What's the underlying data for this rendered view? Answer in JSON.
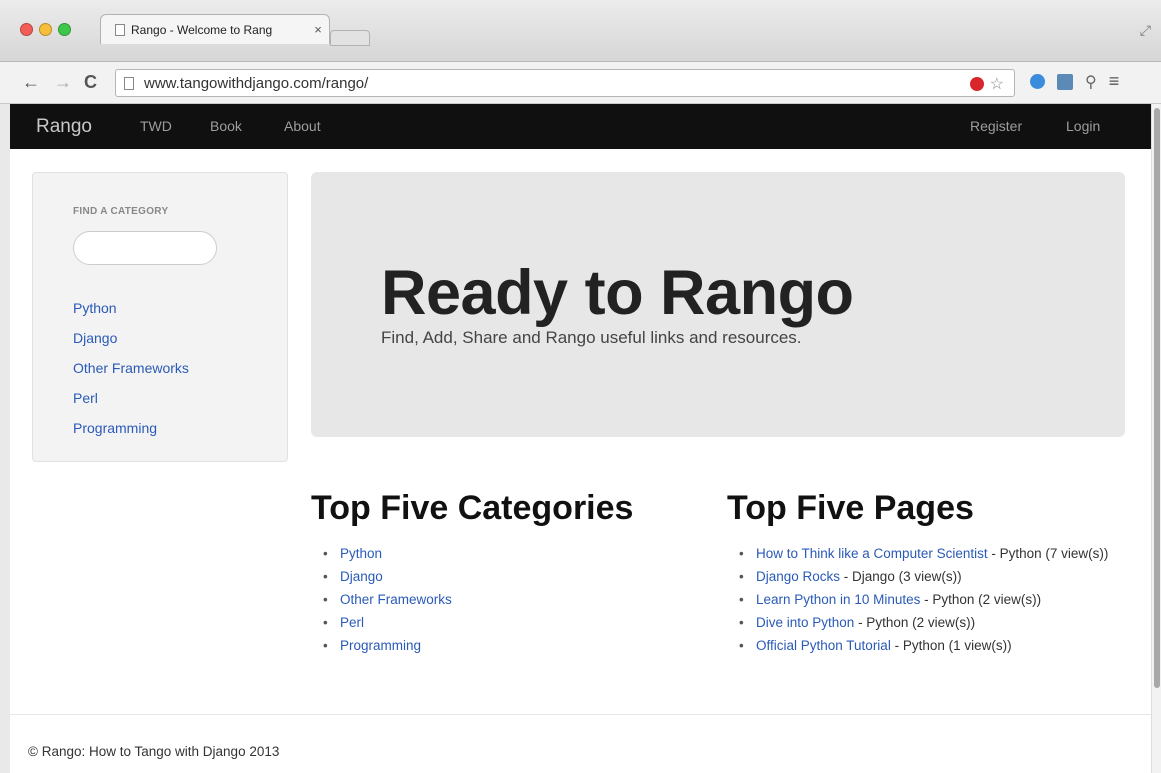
{
  "browser": {
    "tab_title": "Rango - Welcome to Rang",
    "tab_close": "×",
    "url": "www.tangowithdjango.com/rango/"
  },
  "navbar": {
    "brand": "Rango",
    "links": [
      "TWD",
      "Book",
      "About"
    ],
    "right_links": [
      "Register",
      "Login"
    ]
  },
  "sidebar": {
    "heading": "FIND A CATEGORY",
    "search_value": "",
    "categories": [
      "Python",
      "Django",
      "Other Frameworks",
      "Perl",
      "Programming"
    ]
  },
  "hero": {
    "title": "Ready to Rango",
    "subtitle": "Find, Add, Share and Rango useful links and resources."
  },
  "top_categories": {
    "heading": "Top Five Categories",
    "items": [
      "Python",
      "Django",
      "Other Frameworks",
      "Perl",
      "Programming"
    ]
  },
  "top_pages": {
    "heading": "Top Five Pages",
    "items": [
      {
        "title": "How to Think like a Computer Scientist",
        "meta": " - Python (7 view(s))"
      },
      {
        "title": "Django Rocks",
        "meta": " - Django (3 view(s))"
      },
      {
        "title": "Learn Python in 10 Minutes",
        "meta": " - Python (2 view(s))"
      },
      {
        "title": "Dive into Python",
        "meta": " - Python (2 view(s))"
      },
      {
        "title": "Official Python Tutorial",
        "meta": " - Python (1 view(s))"
      }
    ]
  },
  "footer": {
    "text": "© Rango: How to Tango with Django 2013"
  },
  "colors": {
    "link": "#2a5ab8",
    "navbar_bg": "#101010",
    "hero_bg": "#e7e7e7"
  }
}
